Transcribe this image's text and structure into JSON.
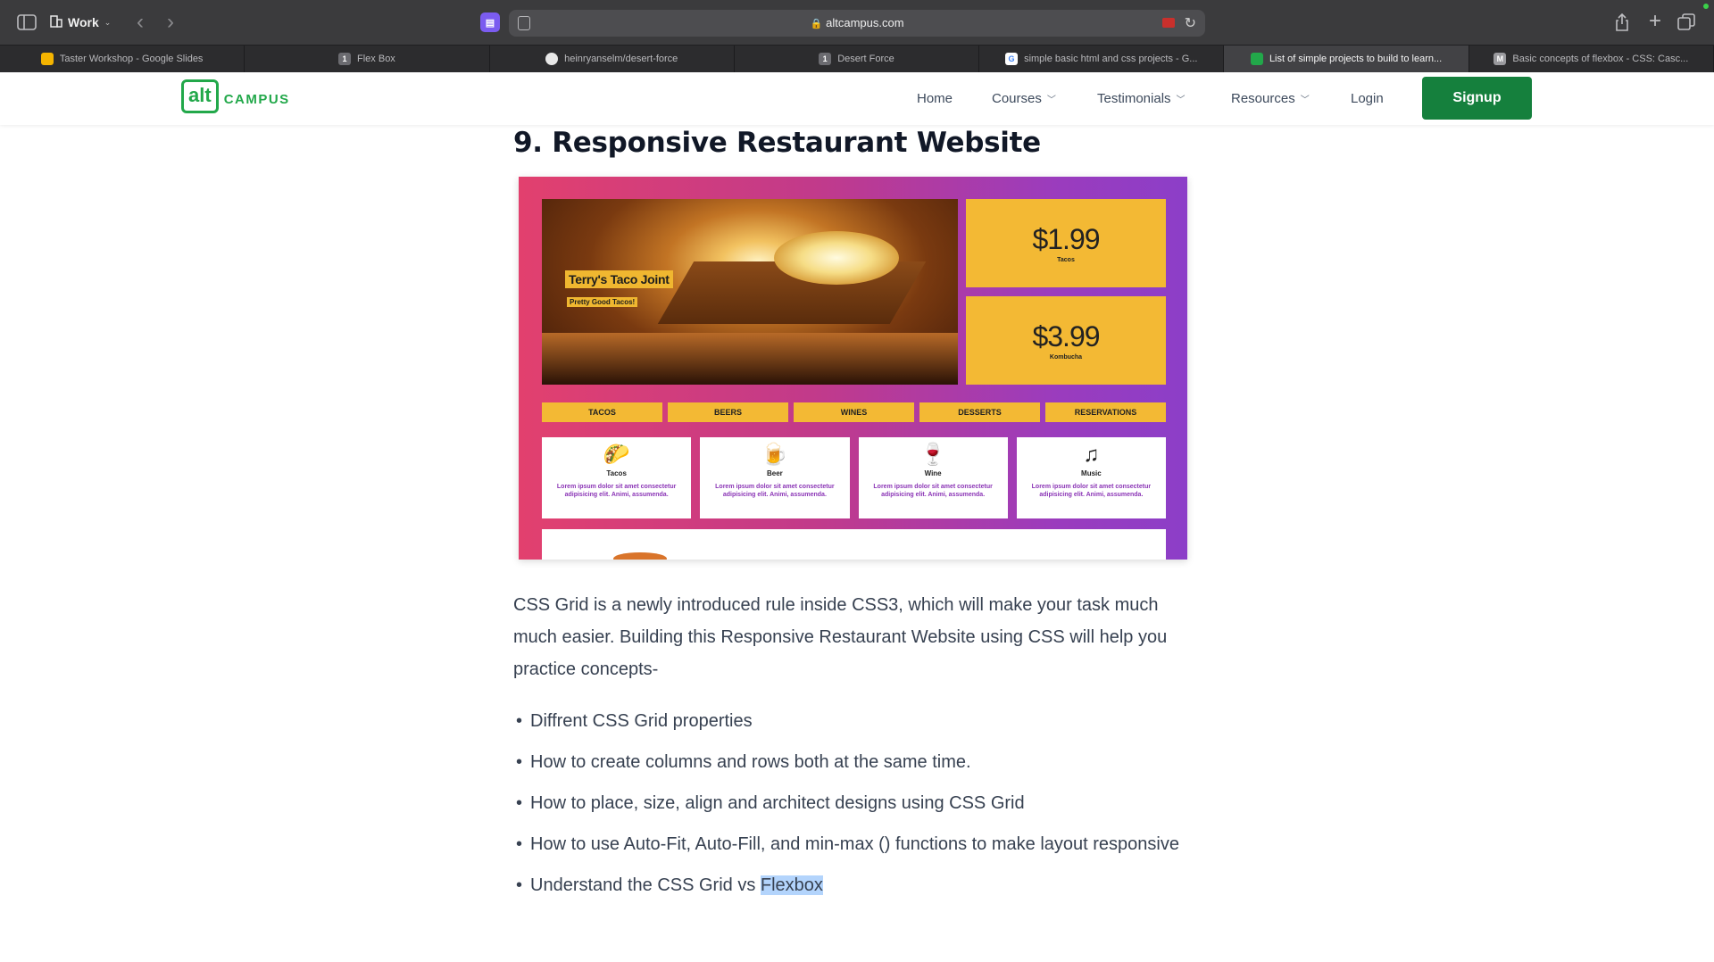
{
  "browser": {
    "profile": "Work",
    "url": "altcampus.com",
    "tabs": [
      {
        "title": "Taster Workshop - Google Slides",
        "favicon": "slides-icon",
        "color": "#f4b400",
        "letter": "",
        "active": false
      },
      {
        "title": "Flex Box",
        "favicon": "one-icon",
        "color": "#6b6b70",
        "letter": "1",
        "active": false
      },
      {
        "title": "heinryanselm/desert-force",
        "favicon": "github-icon",
        "color": "#ffffff",
        "letter": "",
        "active": false
      },
      {
        "title": "Desert Force",
        "favicon": "one-icon",
        "color": "#6b6b70",
        "letter": "1",
        "active": false
      },
      {
        "title": "simple basic html and css projects - G...",
        "favicon": "google-icon",
        "color": "#ffffff",
        "letter": "G",
        "active": false
      },
      {
        "title": "List of simple projects to build to learn...",
        "favicon": "altcampus-icon",
        "color": "#22a84a",
        "letter": "",
        "active": true
      },
      {
        "title": "Basic concepts of flexbox - CSS: Casc...",
        "favicon": "mdn-icon",
        "color": "#9a9a9e",
        "letter": "M",
        "active": false
      }
    ]
  },
  "site": {
    "logo_mark": "alt",
    "logo_text": "CAMPUS",
    "brand_color": "#22a84a",
    "nav": {
      "home": "Home",
      "courses": "Courses",
      "testimonials": "Testimonials",
      "resources": "Resources",
      "login": "Login"
    },
    "signup": "Signup",
    "signup_color": "#15803d"
  },
  "article": {
    "heading": "9. Responsive Restaurant Website",
    "screenshot": {
      "hero_title": "Terry's Taco Joint",
      "hero_subtitle": "Pretty Good Tacos!",
      "prices": [
        {
          "amount": "$1.99",
          "label": "Tacos"
        },
        {
          "amount": "$3.99",
          "label": "Kombucha"
        }
      ],
      "menu": [
        "TACOS",
        "BEERS",
        "WINES",
        "DESSERTS",
        "RESERVATIONS"
      ],
      "cards": [
        {
          "icon": "🌮",
          "icon_name": "taco-icon",
          "name": "Tacos",
          "desc": "Lorem ipsum dolor sit amet consectetur adipisicing elit. Animi, assumenda."
        },
        {
          "icon": "🍺",
          "icon_name": "beer-icon",
          "name": "Beer",
          "desc": "Lorem ipsum dolor sit amet consectetur adipisicing elit. Animi, assumenda."
        },
        {
          "icon": "🍷",
          "icon_name": "wine-icon",
          "name": "Wine",
          "desc": "Lorem ipsum dolor sit amet consectetur adipisicing elit. Animi, assumenda."
        },
        {
          "icon": "♫",
          "icon_name": "music-icon",
          "name": "Music",
          "desc": "Lorem ipsum dolor sit amet consectetur adipisicing elit. Animi, assumenda."
        }
      ]
    },
    "paragraph": "CSS Grid is a newly introduced rule inside CSS3, which will make your task much much easier. Building this Responsive Restaurant Website using CSS will help you practice concepts-",
    "bullets": [
      {
        "text": "Diffrent CSS Grid properties"
      },
      {
        "text": "How to create columns and rows both at the same time."
      },
      {
        "text": "How to place, size, align and architect designs using CSS Grid"
      },
      {
        "text": "How to use Auto-Fit, Auto-Fill, and min-max () functions to make layout responsive"
      },
      {
        "text": "Understand the CSS Grid vs ",
        "highlight": "Flexbox"
      }
    ]
  }
}
